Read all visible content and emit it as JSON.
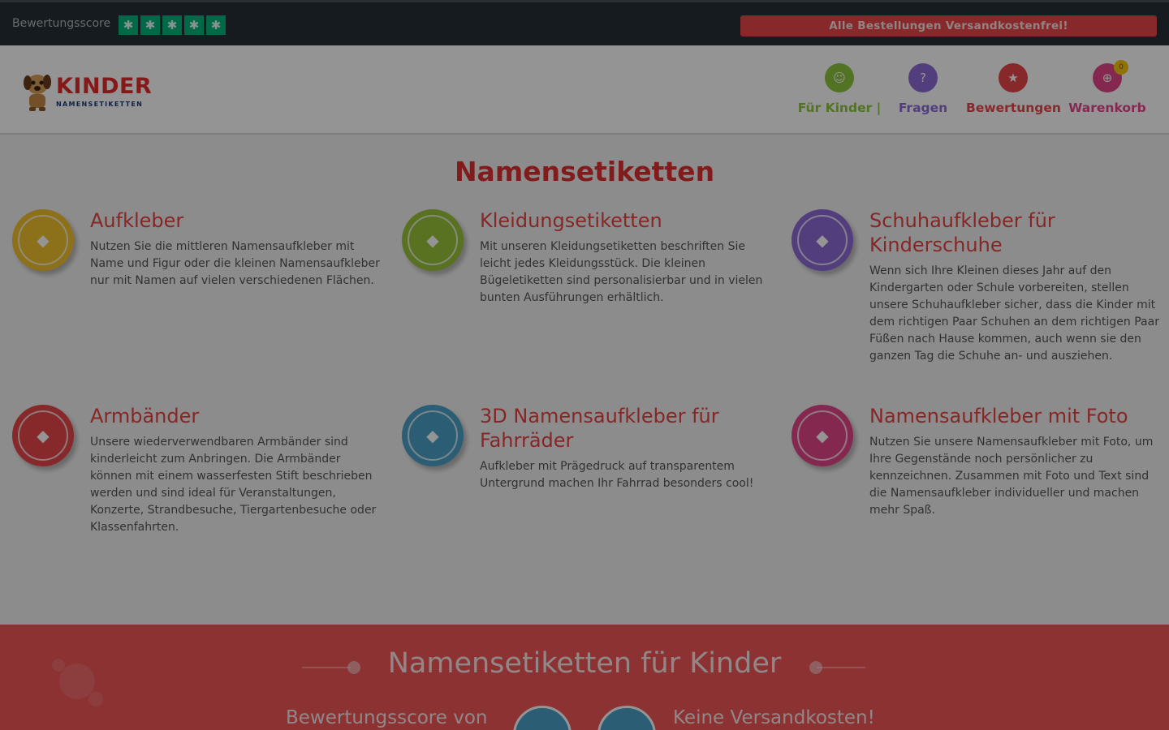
{
  "topbar": {
    "score_label": "Bewertungsscore",
    "stars_count": 5,
    "star_color": "#00b67a",
    "promo_text": "Alle Bestellungen Versandkostenfrei!",
    "promo_color": "#e8484b"
  },
  "header": {
    "logo": {
      "word": "KINDER",
      "sub": "NAMENSETIKETTEN"
    },
    "nav": [
      {
        "label": "Für Kinder |",
        "icon": "child-icon",
        "color": "#8dc63f"
      },
      {
        "label": "Fragen",
        "icon": "question-icon",
        "color": "#8e6bd8"
      },
      {
        "label": "Bewertungen",
        "icon": "star-icon",
        "color": "#e8484b"
      },
      {
        "label": "Warenkorb",
        "icon": "cart-icon",
        "color": "#e5468a",
        "badge": "0"
      }
    ]
  },
  "main": {
    "title": "Namensetiketten",
    "cards": [
      {
        "title": "Aufkleber",
        "icon": "sticker-icon",
        "color": "#f2c12e",
        "desc": "Nutzen Sie die mittleren Namensaufkleber mit Name und Figur oder die kleinen Namensaufkleber nur mit Namen auf vielen verschiedenen Flächen."
      },
      {
        "title": "Kleidungsetiketten",
        "icon": "shirt-icon",
        "color": "#9ac43c",
        "desc": "Mit unseren Kleidungsetiketten beschriften Sie leicht jedes Kleidungsstück. Die kleinen Bügeletiketten sind personalisierbar und in vielen bunten Ausführungen erhältlich."
      },
      {
        "title": "Schuhaufkleber für Kinderschuhe",
        "icon": "shoe-icon",
        "color": "#8e6bd8",
        "desc": "Wenn sich Ihre Kleinen dieses Jahr auf den Kindergarten oder Schule vorbereiten, stellen unsere Schuhaufkleber sicher, dass die Kinder mit dem richtigen Paar Schuhen an dem richtigen Paar Füßen nach Hause kommen, auch wenn sie den ganzen Tag die Schuhe an- und ausziehen."
      },
      {
        "title": "Armbänder",
        "icon": "wristband-icon",
        "color": "#e8484b",
        "desc": "Unsere wiederverwendbaren Armbänder sind kinderleicht zum Anbringen. Die Armbänder können mit einem wasserfesten Stift beschrieben werden und sind ideal für Veranstaltungen, Konzerte, Strandbesuche, Tiergartenbesuche oder Klassenfahrten."
      },
      {
        "title": "3D Namensaufkleber für Fahrräder",
        "icon": "bicycle-icon",
        "color": "#4aa3c9",
        "desc": "Aufkleber mit Prägedruck auf transparentem Untergrund machen Ihr Fahrrad besonders cool!"
      },
      {
        "title": "Namensaufkleber mit Foto",
        "icon": "camera-icon",
        "color": "#e5468a",
        "desc": "Nutzen Sie unsere Namensaufkleber mit Foto, um Ihre Gegenstände noch persönlicher zu kennzeichnen. Zusammen mit Foto und Text sind die Namensaufkleber individueller und machen mehr Spaß."
      }
    ]
  },
  "footer": {
    "title": "Namensetiketten für Kinder",
    "left_text": "Bewertungsscore von",
    "right_text": "Keine Versandkosten!",
    "bg_color": "#f15658"
  }
}
